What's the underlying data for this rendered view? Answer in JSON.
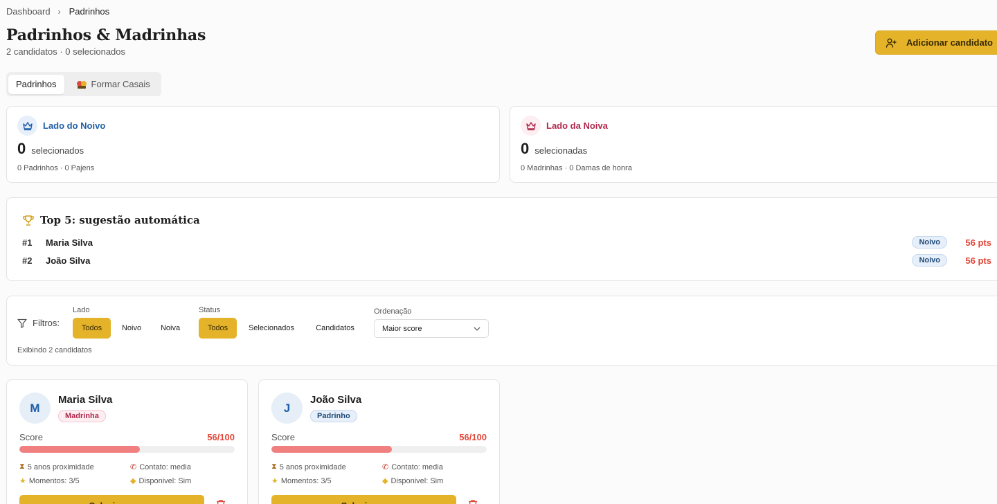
{
  "breadcrumb": {
    "home": "Dashboard",
    "current": "Padrinhos"
  },
  "header": {
    "title": "Padrinhos & Madrinhas",
    "subtitle": "2 candidatos · 0 selecionados",
    "add_button": "Adicionar candidato"
  },
  "tabs": [
    {
      "label": "Padrinhos",
      "active": true
    },
    {
      "label": "Formar Casais",
      "active": false
    }
  ],
  "sides": {
    "noivo": {
      "title": "Lado do Noivo",
      "count": "0",
      "count_label": "selecionados",
      "breakdown": "0 Padrinhos · 0 Pajens",
      "color": "#1f5fa8"
    },
    "noiva": {
      "title": "Lado da Noiva",
      "count": "0",
      "count_label": "selecionadas",
      "breakdown": "0 Madrinhas · 0 Damas de honra",
      "color": "#b0294d"
    }
  },
  "top5": {
    "title": "Top 5: sugestão automática",
    "items": [
      {
        "rank": "#1",
        "name": "Maria Silva",
        "side": "Noivo",
        "pts": "56 pts"
      },
      {
        "rank": "#2",
        "name": "João Silva",
        "side": "Noivo",
        "pts": "56 pts"
      }
    ]
  },
  "filters": {
    "label": "Filtros:",
    "lado": {
      "label": "Lado",
      "options": [
        "Todos",
        "Noivo",
        "Noiva"
      ],
      "selected": "Todos"
    },
    "status": {
      "label": "Status",
      "options": [
        "Todos",
        "Selecionados",
        "Candidatos"
      ],
      "selected": "Todos"
    },
    "ordenacao": {
      "label": "Ordenação",
      "value": "Maior score"
    },
    "showing": "Exibindo 2 candidatos"
  },
  "candidates": [
    {
      "initial": "M",
      "name": "Maria Silva",
      "role": "Madrinha",
      "score_label": "Score",
      "score_text": "56/100",
      "score": 0.56,
      "proximity": "5 anos proximidade",
      "contact": "Contato: media",
      "moments": "Momentos: 3/5",
      "available": "Disponivel: Sim",
      "action": "Selecionar"
    },
    {
      "initial": "J",
      "name": "João Silva",
      "role": "Padrinho",
      "score_label": "Score",
      "score_text": "56/100",
      "score": 0.56,
      "proximity": "5 anos proximidade",
      "contact": "Contato: media",
      "moments": "Momentos: 3/5",
      "available": "Disponivel: Sim",
      "action": "Selecionar"
    }
  ],
  "colors": {
    "accent": "#e4b32a",
    "score": "#e0473a",
    "score_bar": "#f07f7f"
  }
}
